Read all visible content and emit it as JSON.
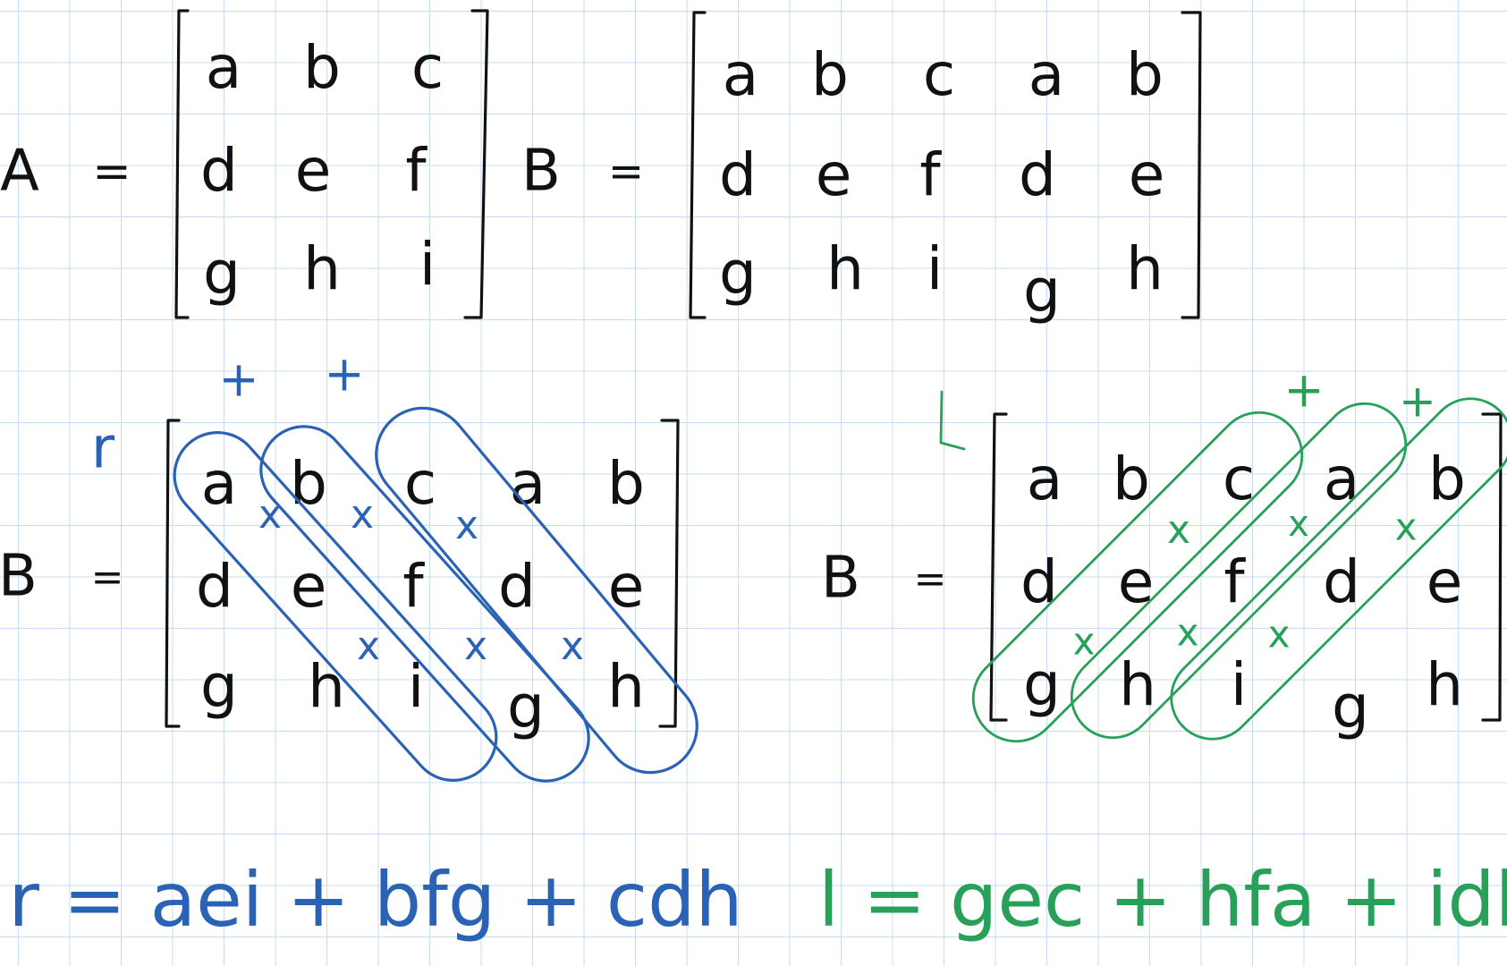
{
  "matrix_a": {
    "name": "A",
    "equals": "=",
    "cells": [
      [
        "a",
        "b",
        "c"
      ],
      [
        "d",
        "e",
        "f"
      ],
      [
        "g",
        "h",
        "i"
      ]
    ]
  },
  "matrix_b": {
    "name": "B",
    "equals": "=",
    "cells": [
      [
        "a",
        "b",
        "c",
        "a",
        "b"
      ],
      [
        "d",
        "e",
        "f",
        "d",
        "e"
      ],
      [
        "g",
        "h",
        "i",
        "g",
        "h"
      ]
    ]
  },
  "right_diagonals": {
    "label": "r",
    "matrix_name": "B",
    "equals": "=",
    "cells": [
      [
        "a",
        "b",
        "c",
        "a",
        "b"
      ],
      [
        "d",
        "e",
        "f",
        "d",
        "e"
      ],
      [
        "g",
        "h",
        "i",
        "g",
        "h"
      ]
    ],
    "plus_marks": [
      "+",
      "+"
    ],
    "times_marks": [
      "x",
      "x",
      "x",
      "x",
      "x",
      "x"
    ],
    "formula": "r = aei + bfg + cdh",
    "color": "#2a62b5"
  },
  "left_diagonals": {
    "label": "l",
    "matrix_name": "B",
    "equals": "=",
    "cells": [
      [
        "a",
        "b",
        "c",
        "a",
        "b"
      ],
      [
        "d",
        "e",
        "f",
        "d",
        "e"
      ],
      [
        "g",
        "h",
        "i",
        "g",
        "h"
      ]
    ],
    "plus_marks": [
      "+",
      "+"
    ],
    "times_marks": [
      "x",
      "x",
      "x",
      "x",
      "x",
      "x"
    ],
    "formula": "l = gec + hfa + idb",
    "color": "#27a05a"
  },
  "ink_color": "#111111",
  "grid_color": "#c6dcf2"
}
